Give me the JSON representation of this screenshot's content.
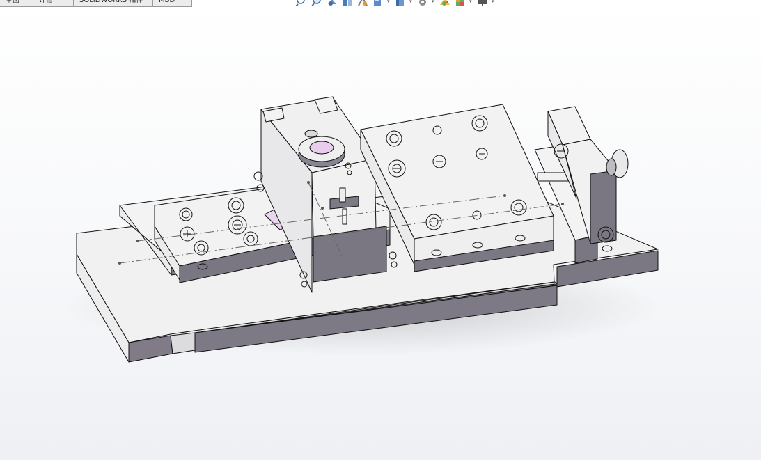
{
  "tabs": [
    {
      "label": "草图"
    },
    {
      "label": "评估"
    },
    {
      "label": "SOLIDWORKS 插件"
    },
    {
      "label": "MBD"
    }
  ],
  "toolbar": {
    "icons": [
      "zoom-to-fit-icon",
      "zoom-area-icon",
      "previous-view-icon",
      "section-view-icon",
      "dynamic-annotation-icon",
      "view-orientation-icon",
      "display-style-icon",
      "hide-show-items-icon",
      "edit-appearance-icon",
      "apply-scene-icon",
      "view-settings-icon"
    ]
  },
  "colors": {
    "face_top": "#f2f2f2",
    "face_side": "#7b7883",
    "face_front": "#dcdcde",
    "edge": "#111111",
    "accent_pink": "#e7c9ee"
  }
}
